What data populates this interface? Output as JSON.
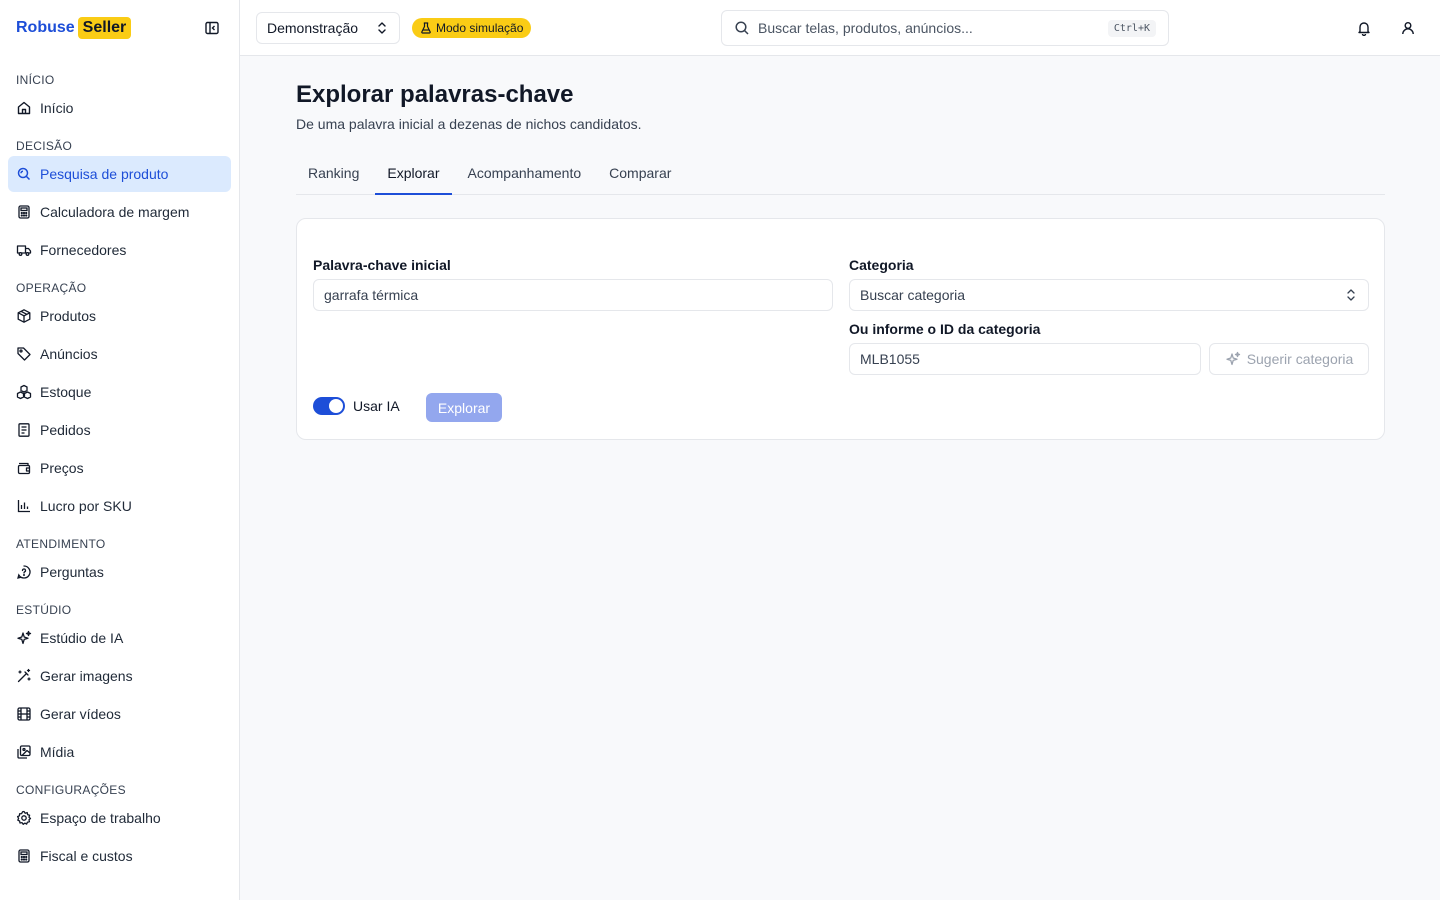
{
  "brand": {
    "name": "Robuse",
    "badge": "Seller"
  },
  "sidebar": {
    "groups": [
      {
        "title": "INÍCIO",
        "items": [
          {
            "label": "Início",
            "icon": "home-icon"
          }
        ]
      },
      {
        "title": "DECISÃO",
        "items": [
          {
            "label": "Pesquisa de produto",
            "icon": "search-zoom-icon",
            "active": true
          },
          {
            "label": "Calculadora de margem",
            "icon": "calculator-icon"
          },
          {
            "label": "Fornecedores",
            "icon": "truck-icon"
          }
        ]
      },
      {
        "title": "OPERAÇÃO",
        "items": [
          {
            "label": "Produtos",
            "icon": "package-icon"
          },
          {
            "label": "Anúncios",
            "icon": "tag-icon"
          },
          {
            "label": "Estoque",
            "icon": "boxes-icon"
          },
          {
            "label": "Pedidos",
            "icon": "receipt-icon"
          },
          {
            "label": "Preços",
            "icon": "wallet-icon"
          },
          {
            "label": "Lucro por SKU",
            "icon": "bar-chart-icon"
          }
        ]
      },
      {
        "title": "ATENDIMENTO",
        "items": [
          {
            "label": "Perguntas",
            "icon": "question-message-icon"
          }
        ]
      },
      {
        "title": "ESTÚDIO",
        "items": [
          {
            "label": "Estúdio de IA",
            "icon": "sparkles-icon"
          },
          {
            "label": "Gerar imagens",
            "icon": "magic-wand-icon"
          },
          {
            "label": "Gerar vídeos",
            "icon": "film-icon"
          },
          {
            "label": "Mídia",
            "icon": "images-icon"
          }
        ]
      },
      {
        "title": "CONFIGURAÇÕES",
        "items": [
          {
            "label": "Espaço de trabalho",
            "icon": "gear-icon"
          },
          {
            "label": "Fiscal e custos",
            "icon": "calculator-icon"
          }
        ]
      }
    ]
  },
  "topbar": {
    "workspace": "Demonstração",
    "sim_badge": "Modo simulação",
    "search_placeholder": "Buscar telas, produtos, anúncios...",
    "search_shortcut": "Ctrl+K"
  },
  "page": {
    "title": "Explorar palavras-chave",
    "subtitle": "De uma palavra inicial a dezenas de nichos candidatos.",
    "tabs": [
      "Ranking",
      "Explorar",
      "Acompanhamento",
      "Comparar"
    ],
    "active_tab": "Explorar"
  },
  "form": {
    "keyword_label": "Palavra-chave inicial",
    "keyword_value": "garrafa térmica",
    "category_label": "Categoria",
    "category_placeholder": "Buscar categoria",
    "category_id_label": "Ou informe o ID da categoria",
    "category_id_value": "MLB1055",
    "suggest_label": "Sugerir categoria",
    "use_ai_label": "Usar IA",
    "use_ai_on": true,
    "explore_label": "Explorar"
  },
  "colors": {
    "accent": "#1d4ed8",
    "badge": "#facc15",
    "active_bg": "#dbeafe"
  }
}
